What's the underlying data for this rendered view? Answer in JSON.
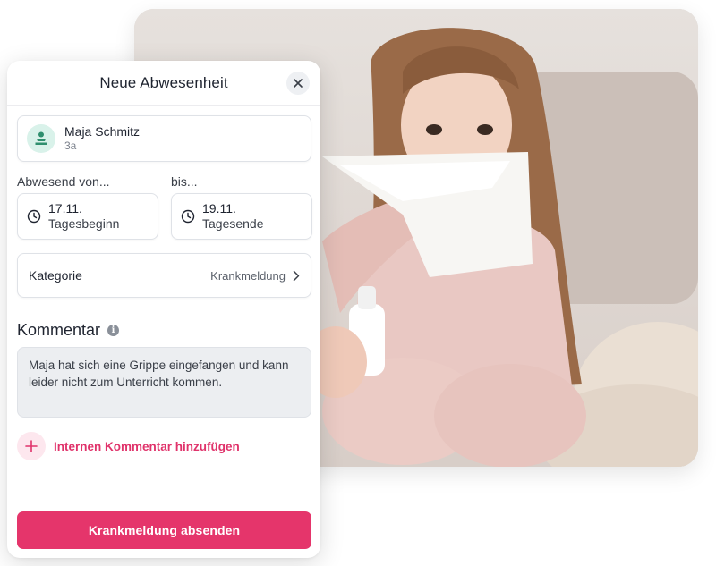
{
  "modal": {
    "title": "Neue Abwesenheit",
    "close_icon": "close-icon"
  },
  "student": {
    "name": "Maja Schmitz",
    "class": "3a",
    "avatar_icon": "student-avatar-icon"
  },
  "absence": {
    "from_label": "Abwesend von...",
    "until_label": "bis...",
    "from_date": "17.11.",
    "from_time": "Tagesbeginn",
    "until_date": "19.11.",
    "until_time": "Tagesende",
    "time_icon": "clock-icon"
  },
  "category": {
    "label": "Kategorie",
    "value": "Krankmeldung",
    "chevron_icon": "chevron-right-icon"
  },
  "comment": {
    "title": "Kommentar",
    "info_icon": "info-icon",
    "text": "Maja hat sich eine Grippe eingefangen und kann leider nicht zum Unterricht kommen."
  },
  "internal_comment": {
    "label": "Internen Kommentar hinzufügen",
    "plus_icon": "plus-icon"
  },
  "submit": {
    "label": "Krankmeldung absenden"
  },
  "colors": {
    "accent": "#e5356b",
    "accent_text": "#e0336b",
    "avatar_bg": "#d9f2ea",
    "avatar_fg": "#2f8f6e"
  }
}
